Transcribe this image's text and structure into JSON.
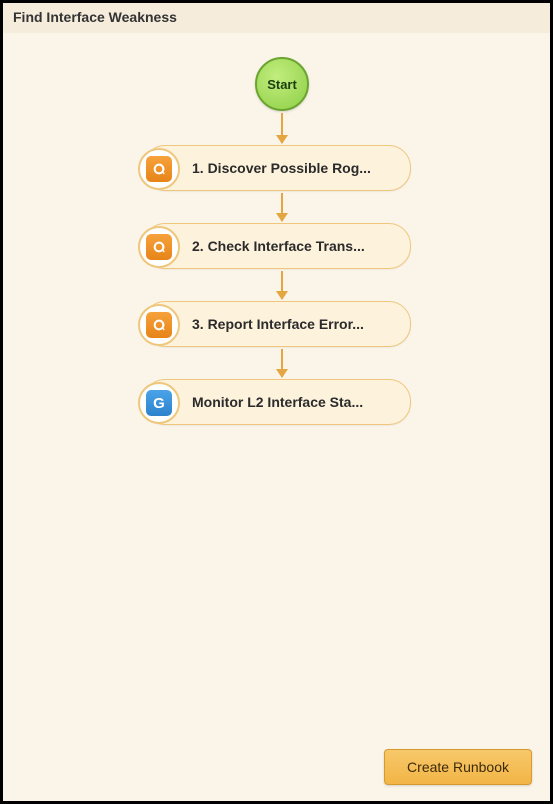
{
  "title": "Find Interface Weakness",
  "start_label": "Start",
  "steps": [
    {
      "label": "1. Discover Possible Rog...",
      "icon": "orange"
    },
    {
      "label": "2. Check Interface Trans...",
      "icon": "orange"
    },
    {
      "label": "3. Report Interface Error...",
      "icon": "orange"
    },
    {
      "label": "Monitor L2 Interface Sta...",
      "icon": "blue"
    }
  ],
  "footer_button": "Create Runbook"
}
